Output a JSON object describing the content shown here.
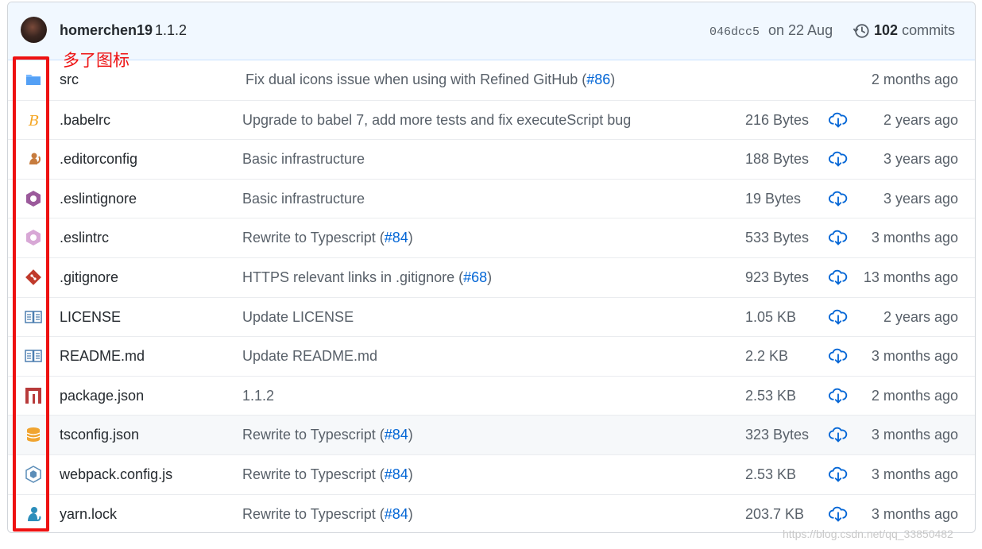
{
  "header": {
    "author": "homerchen19",
    "version": "1.1.2",
    "sha": "046dcc5",
    "date": "on 22 Aug",
    "commit_count": "102",
    "commits_label": "commits"
  },
  "annotation": "多了图标",
  "watermark": "https://blog.csdn.net/qq_33850482",
  "files": [
    {
      "name": "src",
      "icon": "folder-icon",
      "message": "Fix dual icons issue when using with Refined GitHub (",
      "link": "#86",
      "suffix": ")",
      "size": "",
      "age": "2 months ago"
    },
    {
      "name": ".babelrc",
      "icon": "babel-icon",
      "message": "Upgrade to babel 7, add more tests and fix executeScript bug",
      "link": "",
      "suffix": "",
      "size": "216 Bytes",
      "age": "2 years ago"
    },
    {
      "name": ".editorconfig",
      "icon": "editorconfig-icon",
      "message": "Basic infrastructure",
      "link": "",
      "suffix": "",
      "size": "188 Bytes",
      "age": "3 years ago"
    },
    {
      "name": ".eslintignore",
      "icon": "eslint-icon",
      "message": "Basic infrastructure",
      "link": "",
      "suffix": "",
      "size": "19 Bytes",
      "age": "3 years ago"
    },
    {
      "name": ".eslintrc",
      "icon": "eslint-light-icon",
      "message": "Rewrite to Typescript (",
      "link": "#84",
      "suffix": ")",
      "size": "533 Bytes",
      "age": "3 months ago"
    },
    {
      "name": ".gitignore",
      "icon": "git-icon",
      "message": "HTTPS relevant links in .gitignore (",
      "link": "#68",
      "suffix": ")",
      "size": "923 Bytes",
      "age": "13 months ago"
    },
    {
      "name": "LICENSE",
      "icon": "book-icon",
      "message": "Update LICENSE",
      "link": "",
      "suffix": "",
      "size": "1.05 KB",
      "age": "2 years ago"
    },
    {
      "name": "README.md",
      "icon": "book-icon",
      "message": "Update README.md",
      "link": "",
      "suffix": "",
      "size": "2.2 KB",
      "age": "3 months ago"
    },
    {
      "name": "package.json",
      "icon": "npm-icon",
      "message": "1.1.2",
      "link": "",
      "suffix": "",
      "size": "2.53 KB",
      "age": "2 months ago"
    },
    {
      "name": "tsconfig.json",
      "icon": "database-icon",
      "message": "Rewrite to Typescript (",
      "link": "#84",
      "suffix": ")",
      "size": "323 Bytes",
      "age": "3 months ago"
    },
    {
      "name": "webpack.config.js",
      "icon": "webpack-icon",
      "message": "Rewrite to Typescript (",
      "link": "#84",
      "suffix": ")",
      "size": "2.53 KB",
      "age": "3 months ago"
    },
    {
      "name": "yarn.lock",
      "icon": "yarn-icon",
      "message": "Rewrite to Typescript (",
      "link": "#84",
      "suffix": ")",
      "size": "203.7 KB",
      "age": "3 months ago"
    }
  ],
  "colors": {
    "header_bg": "#f1f8ff",
    "link": "#0366d6",
    "muted": "#586069",
    "annotation": "#ee1111"
  }
}
